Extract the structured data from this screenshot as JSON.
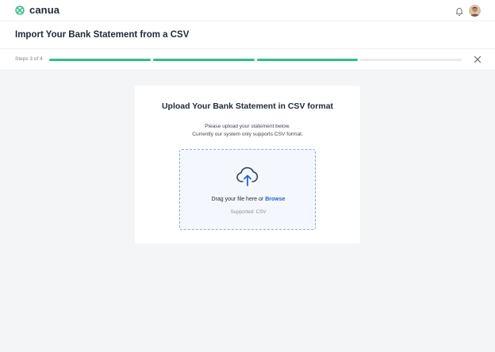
{
  "header": {
    "brand": "canua",
    "brand_color": "#2fbf84",
    "notification_icon": "bell-icon",
    "avatar": "user-avatar"
  },
  "page": {
    "title": "Import Your Bank Statement from a CSV"
  },
  "steps": {
    "label": "Steps 3 of 4",
    "current": 3,
    "total": 4,
    "progress_color": "#2fbf84",
    "close_icon": "close-icon"
  },
  "upload": {
    "title": "Upload Your Bank Statement in CSV format",
    "description_line1": "Please upload your statement below.",
    "description_line2": "Currently our system only supports CSV format.",
    "drop_text": "Drag your file here or",
    "browse_label": "Browse",
    "supported": "Supported: CSV",
    "icon": "cloud-upload-icon",
    "accent_color": "#2466d1"
  }
}
